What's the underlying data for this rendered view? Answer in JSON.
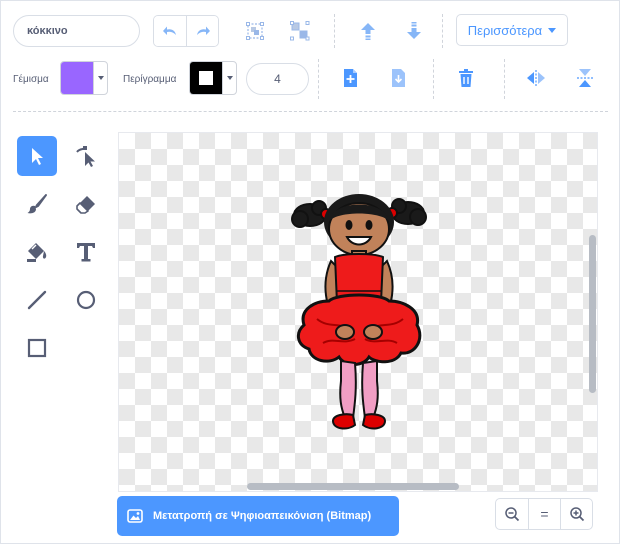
{
  "costume": {
    "name": "κόκκινο"
  },
  "toolbar": {
    "more_label": "Περισσότερα",
    "fill_label": "Γέμισμα",
    "outline_label": "Περίγραμμα",
    "outline_width": "4"
  },
  "colors": {
    "fill": "#9966ff",
    "outline": "#000000",
    "accent": "#4c97ff",
    "text": "#575e75"
  },
  "tools": [
    "select",
    "reshape",
    "brush",
    "eraser",
    "fill",
    "text",
    "line",
    "circle",
    "rectangle"
  ],
  "active_tool": "select",
  "bottom": {
    "convert_label": "Μετατροπή σε Ψηφιοαπεικόνιση (Bitmap)",
    "zoom_reset_label": "="
  }
}
